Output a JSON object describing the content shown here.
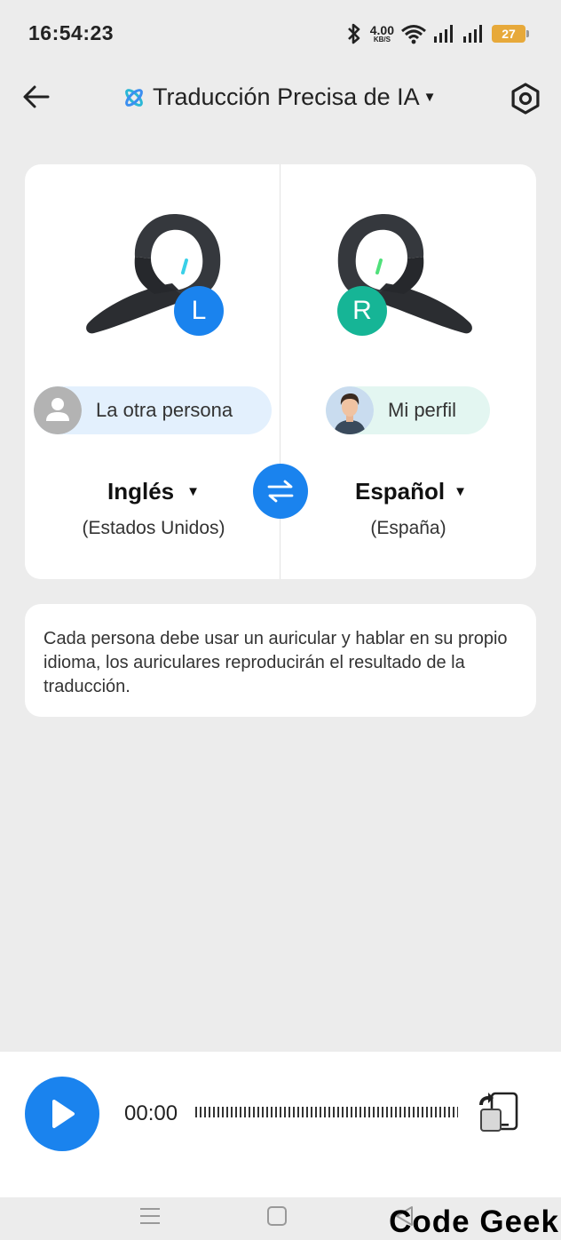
{
  "status_bar": {
    "time": "16:54:23",
    "net_speed": "4.00",
    "net_unit": "KB/S",
    "battery": "27",
    "icons": [
      "bluetooth-icon",
      "wifi-icon",
      "signal-icon",
      "signal-icon"
    ]
  },
  "header": {
    "title": "Traducción Precisa de IA",
    "back_icon": "back-arrow-icon",
    "settings_icon": "gear-icon",
    "logo_icon": "ai-logo-icon"
  },
  "left": {
    "badge": "L",
    "person_label": "La otra persona",
    "language": "Inglés",
    "region": "(Estados Unidos)"
  },
  "right": {
    "badge": "R",
    "person_label": "Mi perfil",
    "language": "Español",
    "region": "(España)"
  },
  "info_text": "Cada persona debe usar un auricular y hablar en su propio idioma, los auriculares reproducirán el resultado de la traducción.",
  "player": {
    "elapsed": "00:00"
  },
  "watermark": "Code Geek",
  "colors": {
    "accent": "#1a83ee",
    "left_badge": "#1a83ee",
    "right_badge": "#16b596",
    "left_pill_bg": "#e3f0fd",
    "right_pill_bg": "#e3f6f1",
    "battery": "#e7a93a"
  }
}
